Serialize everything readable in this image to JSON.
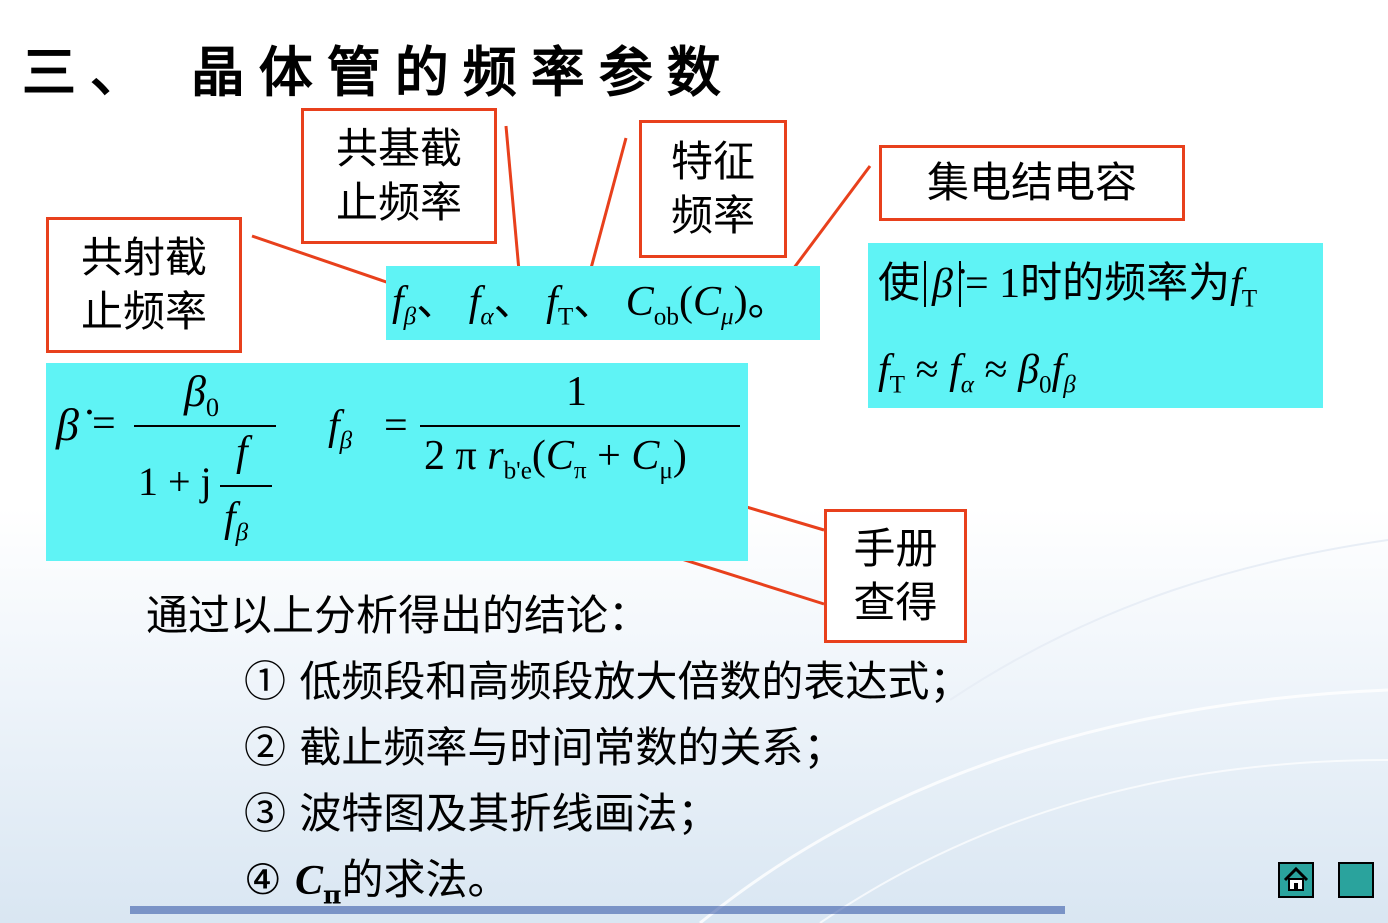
{
  "title": "三、 晶体管的频率参数",
  "callouts": {
    "common_emitter": [
      "共射截",
      "止频率"
    ],
    "common_base": [
      "共基截",
      "止频率"
    ],
    "characteristic": [
      "特征",
      "频率"
    ],
    "collector_capacitance": "集电结电容",
    "manual": [
      "手册",
      "查得"
    ]
  },
  "params_line": {
    "sep": "、",
    "end": "。",
    "f_beta": "f",
    "f_beta_sub": "β",
    "f_alpha": "f",
    "f_alpha_sub": "α",
    "f_T": "f",
    "f_T_sub": "T",
    "C_ob": "C",
    "C_ob_sub": "ob",
    "C_mu": "C",
    "C_mu_sub": "μ"
  },
  "fT_definition": {
    "prefix": "使",
    "beta_dot": "β̇",
    "eq": "= 1时的频率为",
    "f": "f",
    "f_sub": "T"
  },
  "fT_relation": {
    "f_T": "f",
    "f_T_sub": "T",
    "approx": "≈",
    "f_alpha": "f",
    "f_alpha_sub": "α",
    "beta0": "β",
    "beta0_sub": "0",
    "f_beta": "f",
    "f_beta_sub": "β"
  },
  "beta_formula": {
    "lhs": "β̇",
    "eq": "=",
    "num": "β",
    "num_sub": "0",
    "den_prefix": "1 + j",
    "inner_num": "f",
    "inner_den": "f",
    "inner_den_sub": "β"
  },
  "fbeta_formula": {
    "lhs": "f",
    "lhs_sub": "β",
    "eq": "=",
    "num": "1",
    "den_2pi": "2 π",
    "r": "r",
    "r_sub": "b'e",
    "open": "(",
    "C_pi": "C",
    "C_pi_sub": "π",
    "plus": "+",
    "C_mu": "C",
    "C_mu_sub": "μ",
    "close": ")"
  },
  "conclusion": {
    "intro": "通过以上分析得出的结论：",
    "items": [
      "① 低频段和高频段放大倍数的表达式；",
      "② 截止频率与时间常数的关系；",
      "③ 波特图及其折线画法；"
    ],
    "item4_prefix": "④ ",
    "item4_C": "C",
    "item4_sub": "π",
    "item4_suffix": "的求法。"
  },
  "nav": {
    "home_icon": "home-icon",
    "next_icon": "square-icon"
  },
  "colors": {
    "accent_red": "#e8401c",
    "cyan": "#5ff3f5",
    "nav_teal": "#2aa39d"
  }
}
